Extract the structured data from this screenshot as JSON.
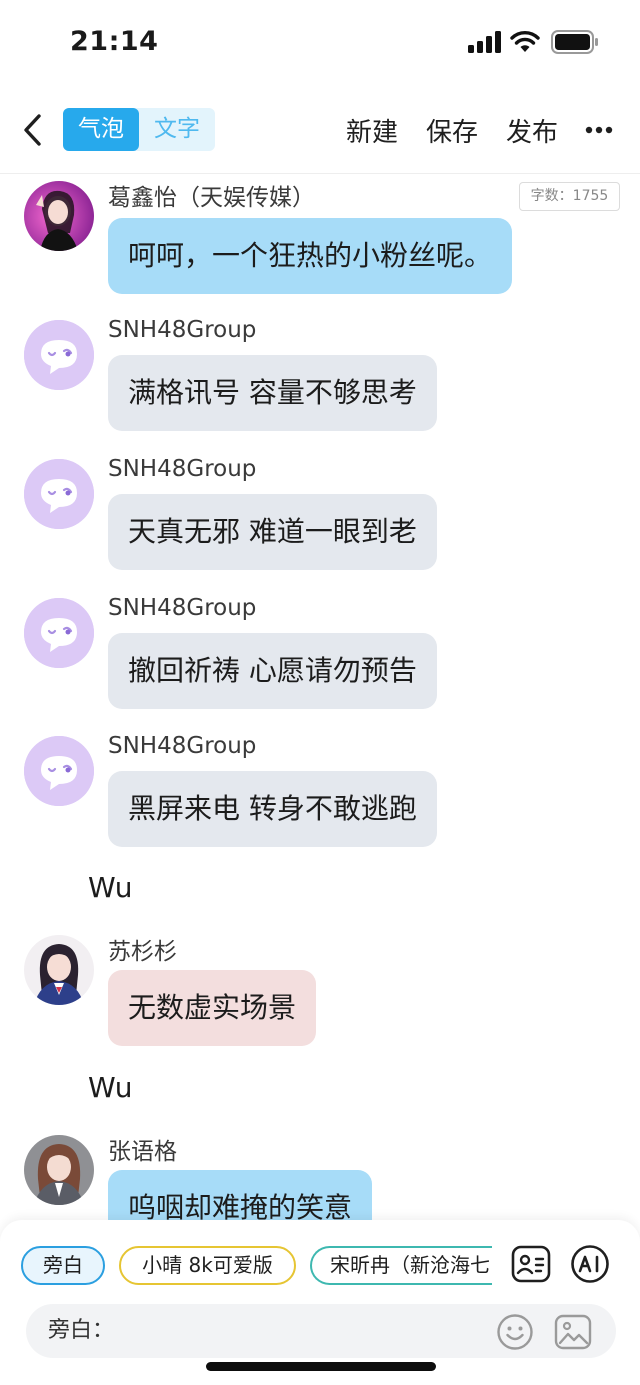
{
  "status_bar": {
    "time": "21:14"
  },
  "nav": {
    "mode_active": "气泡",
    "mode_inactive": "文字",
    "new_label": "新建",
    "save_label": "保存",
    "publish_label": "发布"
  },
  "word_count": "字数：1755",
  "messages": [
    {
      "sender": "葛鑫怡（天娱传媒）",
      "text": "呵呵，一个狂热的小粉丝呢。"
    },
    {
      "sender": "SNH48Group",
      "text": "满格讯号 容量不够思考"
    },
    {
      "sender": "SNH48Group",
      "text": "天真无邪 难道一眼到老"
    },
    {
      "sender": "SNH48Group",
      "text": "撤回祈祷 心愿请勿预告"
    },
    {
      "sender": "SNH48Group",
      "text": "黑屏来电 转身不敢逃跑"
    },
    {
      "narration": "Wu"
    },
    {
      "sender": "苏杉杉",
      "text": "无数虚实场景"
    },
    {
      "narration": "Wu"
    },
    {
      "sender": "张语格",
      "text": "呜咽却难掩的笑意"
    }
  ],
  "bottom": {
    "chips": [
      "旁白",
      "小晴 8k可爱版",
      "宋昕冉（新沧海七"
    ],
    "input_label": "旁白："
  },
  "colors": {
    "accent": "#27a9ec",
    "bubble_blue": "#a7dcf8",
    "bubble_gray": "#e4e8ee",
    "bubble_pink": "#f3dede",
    "group_avatar": "#dcc9f6"
  }
}
